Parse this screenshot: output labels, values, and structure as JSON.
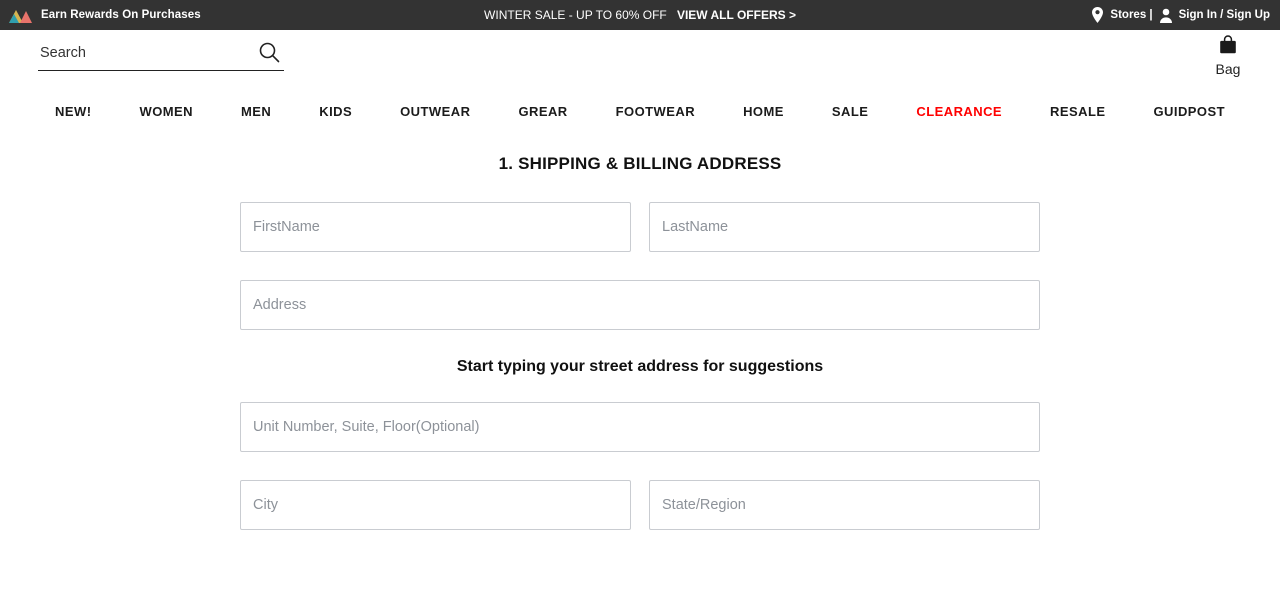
{
  "topbar": {
    "logo_icon": "mountain-logo-icon",
    "logo_colors": {
      "left_peak": "#d6b451",
      "left_base": "#2f9fae",
      "right_peak": "#e8736b"
    },
    "rewards_label": "Earn Rewards On Purchases",
    "promo_text": "WINTER SALE - UP TO 60% OFF",
    "promo_link_label": "VIEW ALL OFFERS >",
    "stores_icon": "location-pin-icon",
    "stores_label": "Stores |",
    "account_icon": "user-icon",
    "account_label": "Sign In / Sign Up",
    "background_color": "#333333"
  },
  "header": {
    "search_placeholder": "Search",
    "search_value": "",
    "search_icon": "search-icon",
    "bag_icon": "shopping-bag-icon",
    "bag_label": "Bag"
  },
  "nav": {
    "items": [
      {
        "label": "NEW!",
        "accent": false
      },
      {
        "label": "WOMEN",
        "accent": false
      },
      {
        "label": "MEN",
        "accent": false
      },
      {
        "label": "KIDS",
        "accent": false
      },
      {
        "label": "OUTWEAR",
        "accent": false
      },
      {
        "label": "GREAR",
        "accent": false
      },
      {
        "label": "FOOTWEAR",
        "accent": false
      },
      {
        "label": "HOME",
        "accent": false
      },
      {
        "label": "SALE",
        "accent": false
      },
      {
        "label": "CLEARANCE",
        "accent": true
      },
      {
        "label": "RESALE",
        "accent": false
      },
      {
        "label": "GUIDPOST",
        "accent": false
      }
    ],
    "accent_color": "#ff0000"
  },
  "checkout": {
    "section_title": "1. SHIPPING & BILLING ADDRESS",
    "address_hint": "Start typing your street address for suggestions",
    "fields": {
      "first_name": {
        "placeholder": "FirstName",
        "value": ""
      },
      "last_name": {
        "placeholder": "LastName",
        "value": ""
      },
      "address": {
        "placeholder": "Address",
        "value": ""
      },
      "unit": {
        "placeholder": "Unit Number, Suite, Floor(Optional)",
        "value": ""
      },
      "city": {
        "placeholder": "City",
        "value": ""
      },
      "state": {
        "placeholder": "State/Region",
        "value": ""
      }
    }
  }
}
